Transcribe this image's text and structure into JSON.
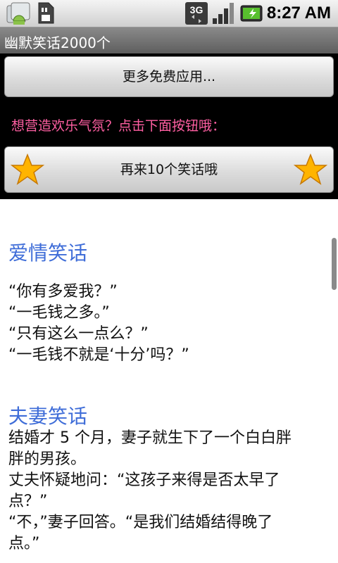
{
  "status_bar": {
    "time": "8:27 AM",
    "network_label": "3G",
    "icons": [
      "android-icon",
      "sdcard-icon",
      "3g-icon",
      "signal-icon",
      "battery-icon"
    ]
  },
  "title_bar": {
    "title": "幽默笑话2000个"
  },
  "header": {
    "more_apps_label": "更多免费应用...",
    "prompt_text": "想营造欢乐气氛？点击下面按钮哦：",
    "more_jokes_label": "再来10个笑话哦"
  },
  "jokes": [
    {
      "heading": "爱情笑话",
      "lines": [
        "“你有多爱我？”",
        "“一毛钱之多。”",
        "“只有这么一点么？”",
        "“一毛钱不就是‘十分’吗？”"
      ]
    },
    {
      "heading": "夫妻笑话",
      "lines": [
        "结婚才 5 个月，妻子就生下了一个白白胖",
        "胖的男孩。",
        "丈夫怀疑地问：“这孩子来得是否太早了",
        "点？”",
        "“不，”妻子回答。“是我们结婚结得晚了",
        "点。”"
      ]
    }
  ],
  "colors": {
    "heading": "#3f6dd8",
    "prompt": "#ff5fa2",
    "title_bar": "#6e6e6e"
  }
}
